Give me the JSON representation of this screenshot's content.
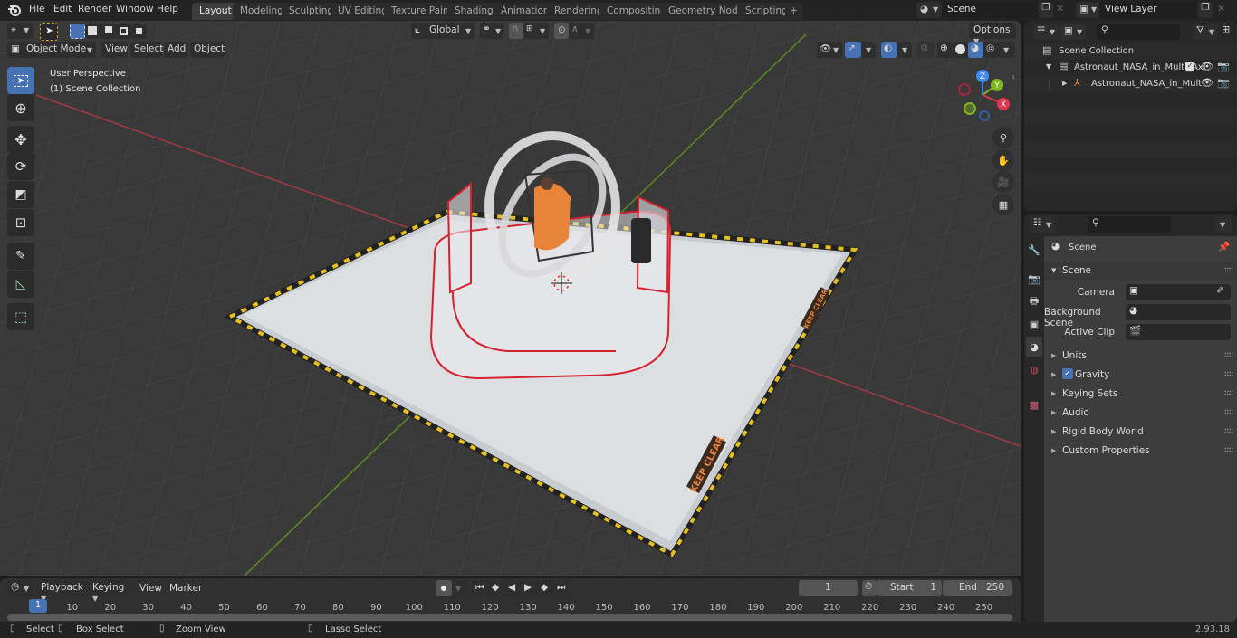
{
  "app": {
    "version": "2.93.18"
  },
  "menu": [
    "File",
    "Edit",
    "Render",
    "Window",
    "Help"
  ],
  "workspaces": [
    {
      "label": "Layout",
      "active": true
    },
    {
      "label": "Modeling"
    },
    {
      "label": "Sculpting"
    },
    {
      "label": "UV Editing"
    },
    {
      "label": "Texture Paint"
    },
    {
      "label": "Shading"
    },
    {
      "label": "Animation"
    },
    {
      "label": "Rendering"
    },
    {
      "label": "Compositing"
    },
    {
      "label": "Geometry Nodes"
    },
    {
      "label": "Scripting"
    }
  ],
  "add_workspace": "+",
  "scene_selector": {
    "value": "Scene"
  },
  "view_layer_selector": {
    "value": "View Layer"
  },
  "viewport": {
    "mode": "Object Mode",
    "menus": [
      "View",
      "Select",
      "Add",
      "Object"
    ],
    "transform_orientation": "Global",
    "options_label": "Options",
    "overlay_title": "User Perspective",
    "overlay_subtitle": "(1) Scene Collection",
    "gizmo_axes": {
      "x": "X",
      "y": "Y",
      "z": "Z"
    },
    "floor_labels": [
      "KEEP CLEAR",
      "KEEP CLEAR"
    ]
  },
  "colors": {
    "accent": "#4772b3",
    "axis_x": "#e0344a",
    "axis_y": "#7fb51f",
    "axis_z": "#3d8bf0",
    "object_orange": "#e8833a"
  },
  "outliner": {
    "search_placeholder": "",
    "root": "Scene Collection",
    "items": [
      {
        "label": "Astronaut_NASA_in_Multi_Axi",
        "type": "collection",
        "checked": true
      },
      {
        "label": "Astronaut_NASA_in_Mult",
        "type": "empty"
      }
    ]
  },
  "properties": {
    "search_placeholder": "",
    "context_title": "Scene",
    "section_title": "Scene",
    "fields": [
      {
        "label": "Camera",
        "value": ""
      },
      {
        "label": "Background Scene",
        "value": ""
      },
      {
        "label": "Active Clip",
        "value": ""
      }
    ],
    "panels": [
      {
        "label": "Units"
      },
      {
        "label": "Gravity",
        "checkbox": true,
        "checked": true
      },
      {
        "label": "Keying Sets"
      },
      {
        "label": "Audio"
      },
      {
        "label": "Rigid Body World"
      },
      {
        "label": "Custom Properties"
      }
    ]
  },
  "timeline": {
    "menus": [
      "Playback",
      "Keying",
      "View",
      "Marker"
    ],
    "current_frame": "1",
    "start_label": "Start",
    "start": "1",
    "end_label": "End",
    "end": "250",
    "ticks": [
      "10",
      "20",
      "30",
      "40",
      "50",
      "60",
      "70",
      "80",
      "90",
      "100",
      "110",
      "120",
      "130",
      "140",
      "150",
      "160",
      "170",
      "180",
      "190",
      "200",
      "210",
      "220",
      "230",
      "240",
      "250"
    ],
    "playhead": "1"
  },
  "status": [
    {
      "label": "Select"
    },
    {
      "label": "Box Select"
    },
    {
      "label": "Zoom View"
    },
    {
      "label": "Lasso Select"
    }
  ]
}
